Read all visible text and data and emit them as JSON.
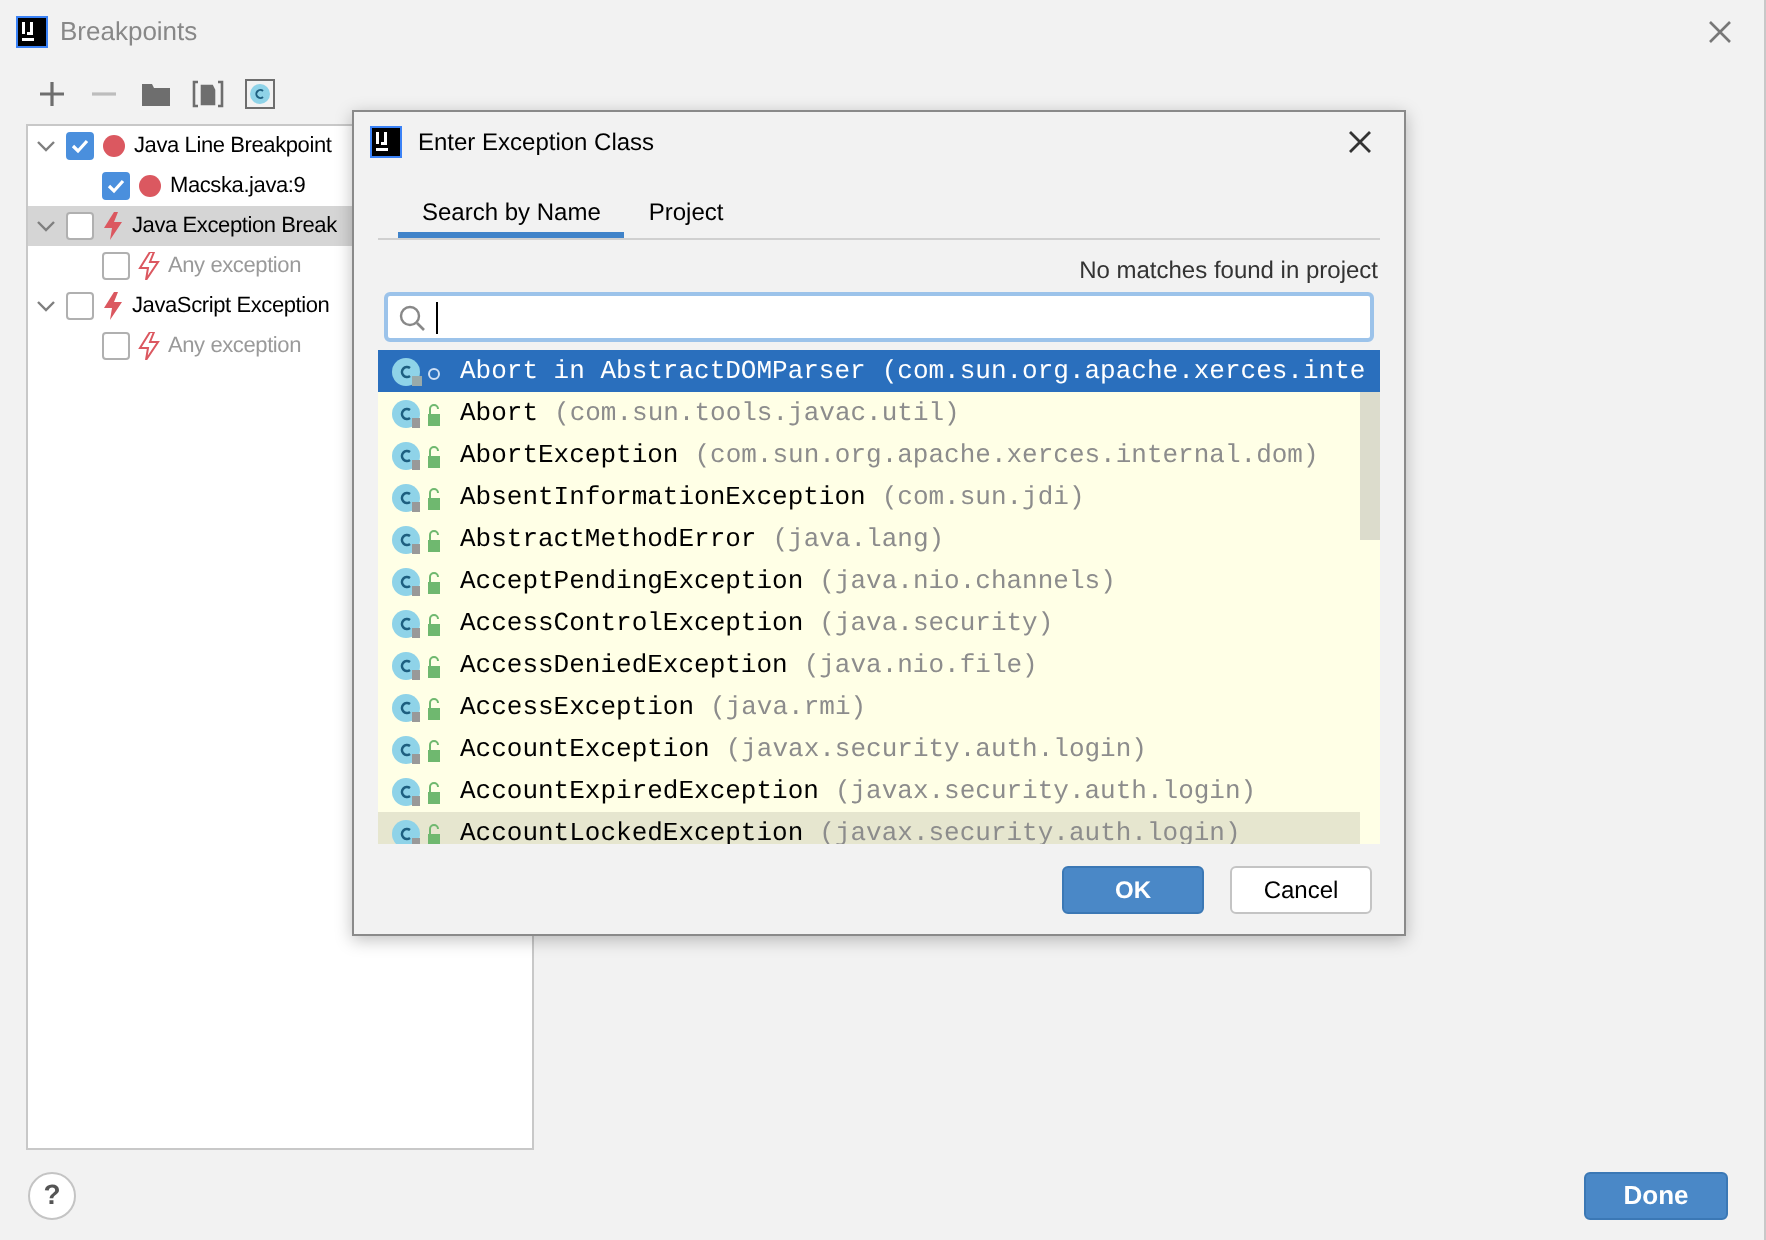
{
  "window": {
    "title": "Breakpoints"
  },
  "toolbar": [
    {
      "kind": "add",
      "disabled": false
    },
    {
      "kind": "remove",
      "disabled": true
    },
    {
      "kind": "folder",
      "disabled": false
    },
    {
      "kind": "file",
      "disabled": false
    },
    {
      "kind": "class",
      "disabled": false
    }
  ],
  "tree": [
    {
      "label": "Java Line Breakpoint",
      "kind": "dot",
      "checked": true,
      "selected": false,
      "disabled": false,
      "expanded": true,
      "children": [
        {
          "label": "Macska.java:9",
          "kind": "dot",
          "checked": true,
          "selected": false,
          "disabled": false
        }
      ]
    },
    {
      "label": "Java Exception Break",
      "kind": "bolt",
      "checked": false,
      "selected": true,
      "disabled": false,
      "expanded": true,
      "children": [
        {
          "label": "Any exception",
          "kind": "bolt",
          "checked": false,
          "selected": false,
          "disabled": true
        }
      ]
    },
    {
      "label": "JavaScript Exception",
      "kind": "bolt",
      "checked": false,
      "selected": false,
      "disabled": false,
      "expanded": true,
      "children": [
        {
          "label": "Any exception",
          "kind": "bolt",
          "checked": false,
          "selected": false,
          "disabled": true
        }
      ]
    }
  ],
  "dialog": {
    "title": "Enter Exception Class",
    "tabs": [
      {
        "label": "Search by Name",
        "selected": true
      },
      {
        "label": "Project",
        "selected": false
      }
    ],
    "status": "No matches found in project",
    "results": [
      {
        "kind": "method",
        "name": "Abort in AbstractDOMParser",
        "package": "(com.sun.org.apache.xerces.inte",
        "selected": true,
        "hovered": false
      },
      {
        "kind": "class",
        "name": "Abort",
        "package": "(com.sun.tools.javac.util)",
        "selected": false,
        "hovered": false
      },
      {
        "kind": "class",
        "name": "AbortException",
        "package": "(com.sun.org.apache.xerces.internal.dom)",
        "selected": false,
        "hovered": false
      },
      {
        "kind": "class",
        "name": "AbsentInformationException",
        "package": "(com.sun.jdi)",
        "selected": false,
        "hovered": false
      },
      {
        "kind": "class",
        "name": "AbstractMethodError",
        "package": "(java.lang)",
        "selected": false,
        "hovered": false
      },
      {
        "kind": "class",
        "name": "AcceptPendingException",
        "package": "(java.nio.channels)",
        "selected": false,
        "hovered": false
      },
      {
        "kind": "class",
        "name": "AccessControlException",
        "package": "(java.security)",
        "selected": false,
        "hovered": false
      },
      {
        "kind": "class",
        "name": "AccessDeniedException",
        "package": "(java.nio.file)",
        "selected": false,
        "hovered": false
      },
      {
        "kind": "class",
        "name": "AccessException",
        "package": "(java.rmi)",
        "selected": false,
        "hovered": false
      },
      {
        "kind": "class",
        "name": "AccountException",
        "package": "(javax.security.auth.login)",
        "selected": false,
        "hovered": false
      },
      {
        "kind": "class",
        "name": "AccountExpiredException",
        "package": "(javax.security.auth.login)",
        "selected": false,
        "hovered": false
      },
      {
        "kind": "class",
        "name": "AccountLockedException",
        "package": "(javax.security.auth.login)",
        "selected": false,
        "hovered": true
      }
    ],
    "buttons": [
      {
        "label": "OK",
        "primary": true
      },
      {
        "label": "Cancel",
        "primary": false
      }
    ]
  },
  "footer": {
    "help": "?",
    "done": "Done"
  }
}
